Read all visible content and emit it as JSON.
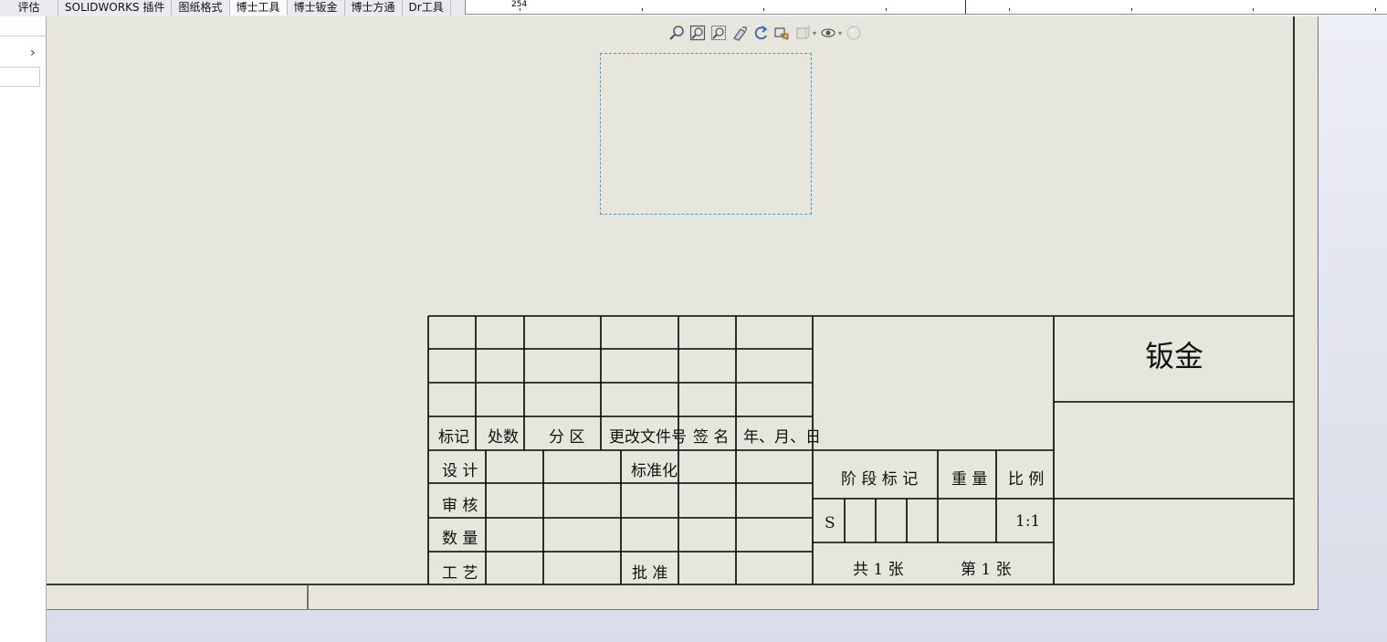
{
  "tabs": [
    {
      "label": "评估",
      "active": false
    },
    {
      "label": "SOLIDWORKS 插件",
      "active": false
    },
    {
      "label": "图纸格式",
      "active": false
    },
    {
      "label": "博士工具",
      "active": true
    },
    {
      "label": "博士钣金",
      "active": false
    },
    {
      "label": "博士方通",
      "active": false
    },
    {
      "label": "Dr工具",
      "active": false
    }
  ],
  "ruler": {
    "label": "254"
  },
  "left_panel": {
    "expand_icon": "chevron-right-icon"
  },
  "view_toolbar": {
    "icons": [
      "zoom-to-fit-icon",
      "zoom-area-icon",
      "zoom-in-out-icon",
      "pan-icon",
      "rotate-icon",
      "previous-view-icon",
      "display-style-icon",
      "hide-show-icon",
      "appearance-icon"
    ]
  },
  "title_block": {
    "revision_headers": [
      "标记",
      "处数",
      "分 区",
      "更改文件号",
      "签 名",
      "年、月、日"
    ],
    "sign_labels": {
      "design": "设 计",
      "standardize": "标准化",
      "review": "审 核",
      "quantity": "数 量",
      "process": "工 艺",
      "approve": "批 准"
    },
    "stage_mark": "阶 段 标 记",
    "weight": "重 量",
    "scale_label": "比 例",
    "stage_value": "S",
    "scale_value": "1:1",
    "sheets_total": "共  1  张",
    "sheet_number": "第  1  张",
    "material": "钣金"
  },
  "colors": {
    "sheet_bg": "#e6e6dc",
    "selection": "#4a9ae0",
    "line": "#000000"
  }
}
